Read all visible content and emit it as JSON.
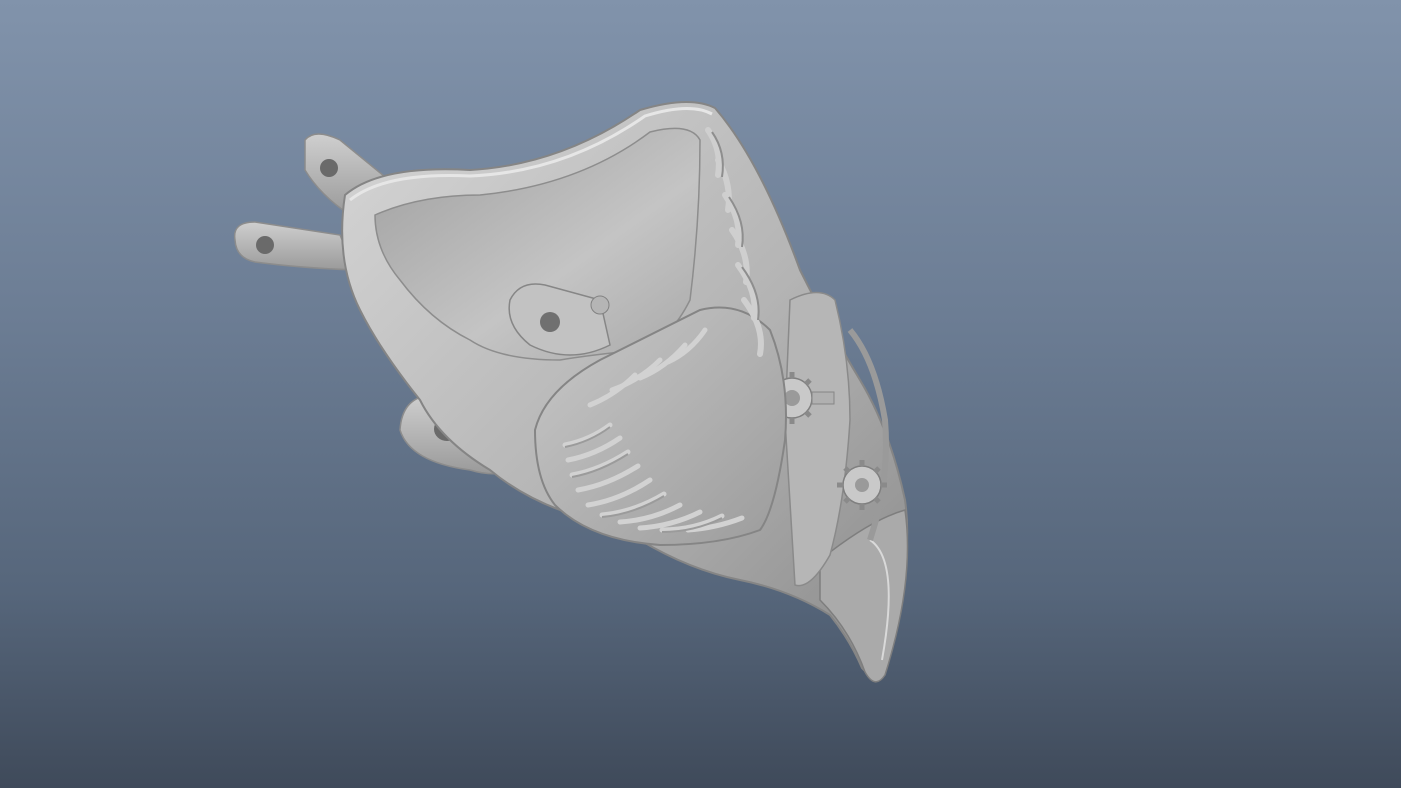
{
  "viewport": {
    "background_top": "#8193ab",
    "background_bottom": "#3f4a5a",
    "model_color": "#bcbcbc",
    "model_shadow": "#7d7d7d",
    "model_highlight": "#e2e2e2"
  },
  "model": {
    "icon": "steampunk-mask-model",
    "parts": [
      "mounting-tab",
      "mounting-tab",
      "mounting-tab",
      "mask-shell",
      "mask-rim",
      "ribbed-vent",
      "gear",
      "gear",
      "beak-tip"
    ]
  }
}
